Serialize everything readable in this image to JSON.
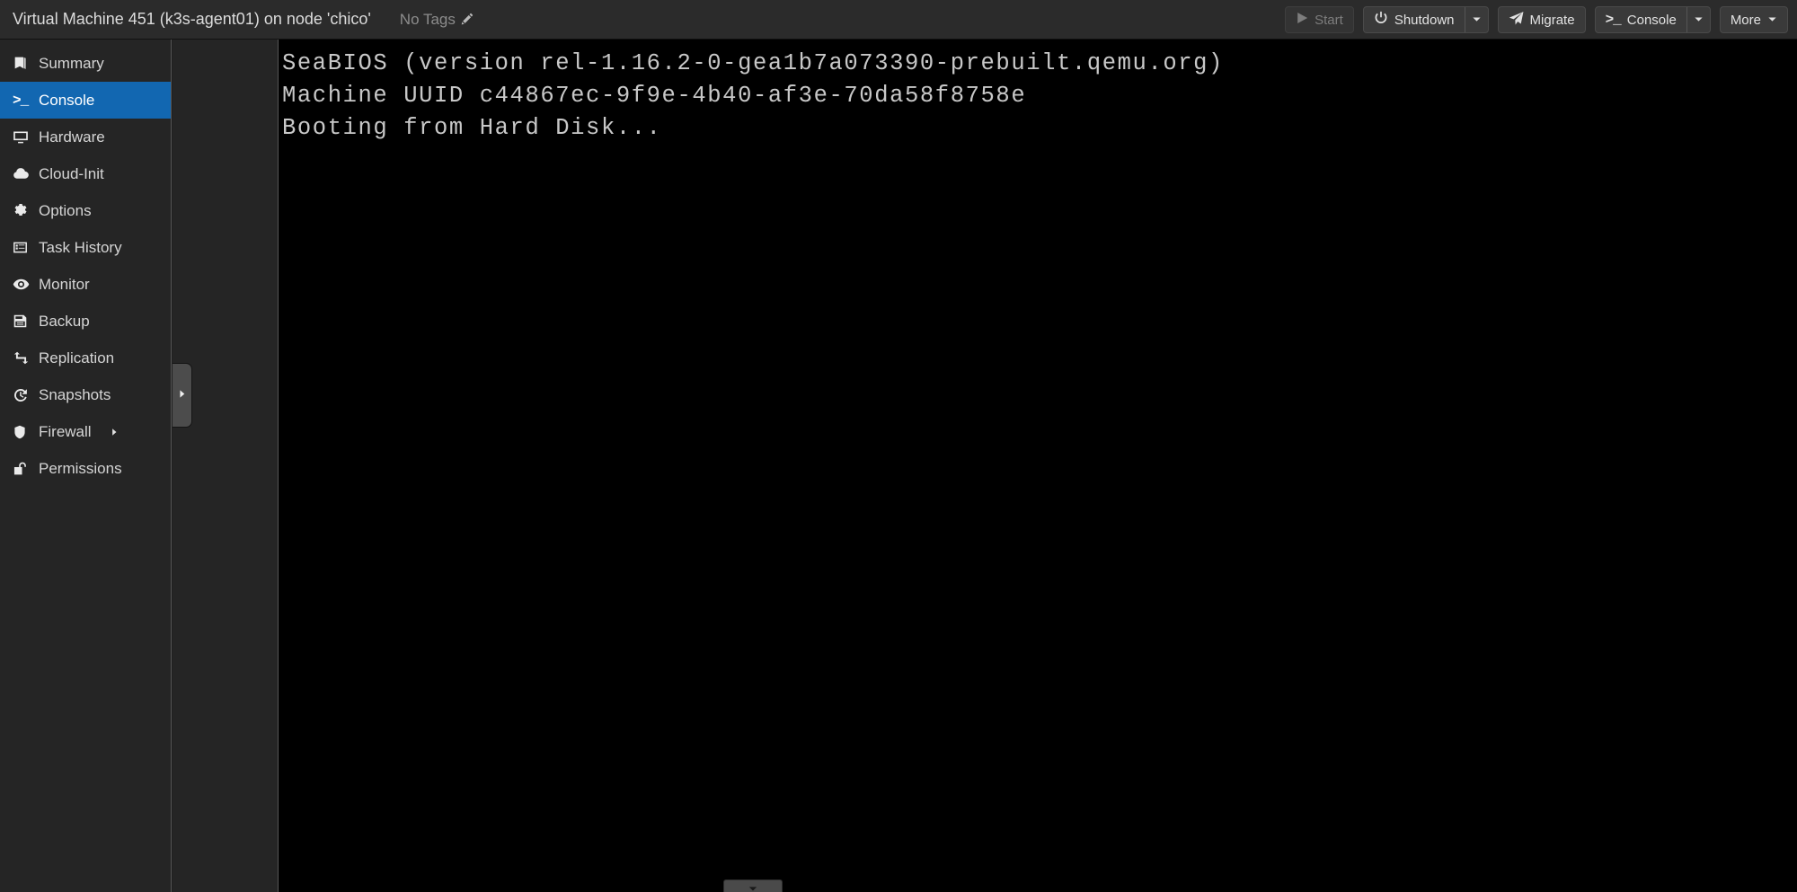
{
  "header": {
    "title": "Virtual Machine 451 (k3s-agent01) on node 'chico'",
    "tags_label": "No Tags",
    "edit_tags_icon": "pencil-icon"
  },
  "toolbar": {
    "buttons": [
      {
        "label": "Start",
        "icon": "play-icon",
        "disabled": true,
        "split": false
      },
      {
        "label": "Shutdown",
        "icon": "power-icon",
        "disabled": false,
        "split": true
      },
      {
        "label": "Migrate",
        "icon": "send-icon",
        "disabled": false,
        "split": false
      },
      {
        "label": "Console",
        "icon": "terminal-icon",
        "disabled": false,
        "split": true
      },
      {
        "label": "More",
        "icon": "chevron-down-icon",
        "disabled": false,
        "split": false
      }
    ]
  },
  "sidebar": {
    "items": [
      {
        "label": "Summary",
        "icon": "book-icon",
        "active": false,
        "submenu": false
      },
      {
        "label": "Console",
        "icon": "terminal-icon",
        "active": true,
        "submenu": false
      },
      {
        "label": "Hardware",
        "icon": "desktop-icon",
        "active": false,
        "submenu": false
      },
      {
        "label": "Cloud-Init",
        "icon": "cloud-icon",
        "active": false,
        "submenu": false
      },
      {
        "label": "Options",
        "icon": "gear-icon",
        "active": false,
        "submenu": false
      },
      {
        "label": "Task History",
        "icon": "list-icon",
        "active": false,
        "submenu": false
      },
      {
        "label": "Monitor",
        "icon": "eye-icon",
        "active": false,
        "submenu": false
      },
      {
        "label": "Backup",
        "icon": "floppy-icon",
        "active": false,
        "submenu": false
      },
      {
        "label": "Replication",
        "icon": "retweet-icon",
        "active": false,
        "submenu": false
      },
      {
        "label": "Snapshots",
        "icon": "history-icon",
        "active": false,
        "submenu": false
      },
      {
        "label": "Firewall",
        "icon": "shield-icon",
        "active": false,
        "submenu": true
      },
      {
        "label": "Permissions",
        "icon": "unlock-icon",
        "active": false,
        "submenu": false
      }
    ],
    "collapse_handle_icon": "caret-right-icon"
  },
  "console": {
    "lines": [
      "SeaBIOS (version rel-1.16.2-0-gea1b7a073390-prebuilt.qemu.org)",
      "Machine UUID c44867ec-9f9e-4b40-af3e-70da58f8758e",
      "Booting from Hard Disk..."
    ],
    "drawer_handle_icon": "chevron-down-icon"
  },
  "colors": {
    "accent": "#1267b1",
    "header_bg": "#2b2b2b",
    "sidebar_bg": "#252525",
    "console_bg": "#000000",
    "console_text": "#c8c8c8"
  }
}
